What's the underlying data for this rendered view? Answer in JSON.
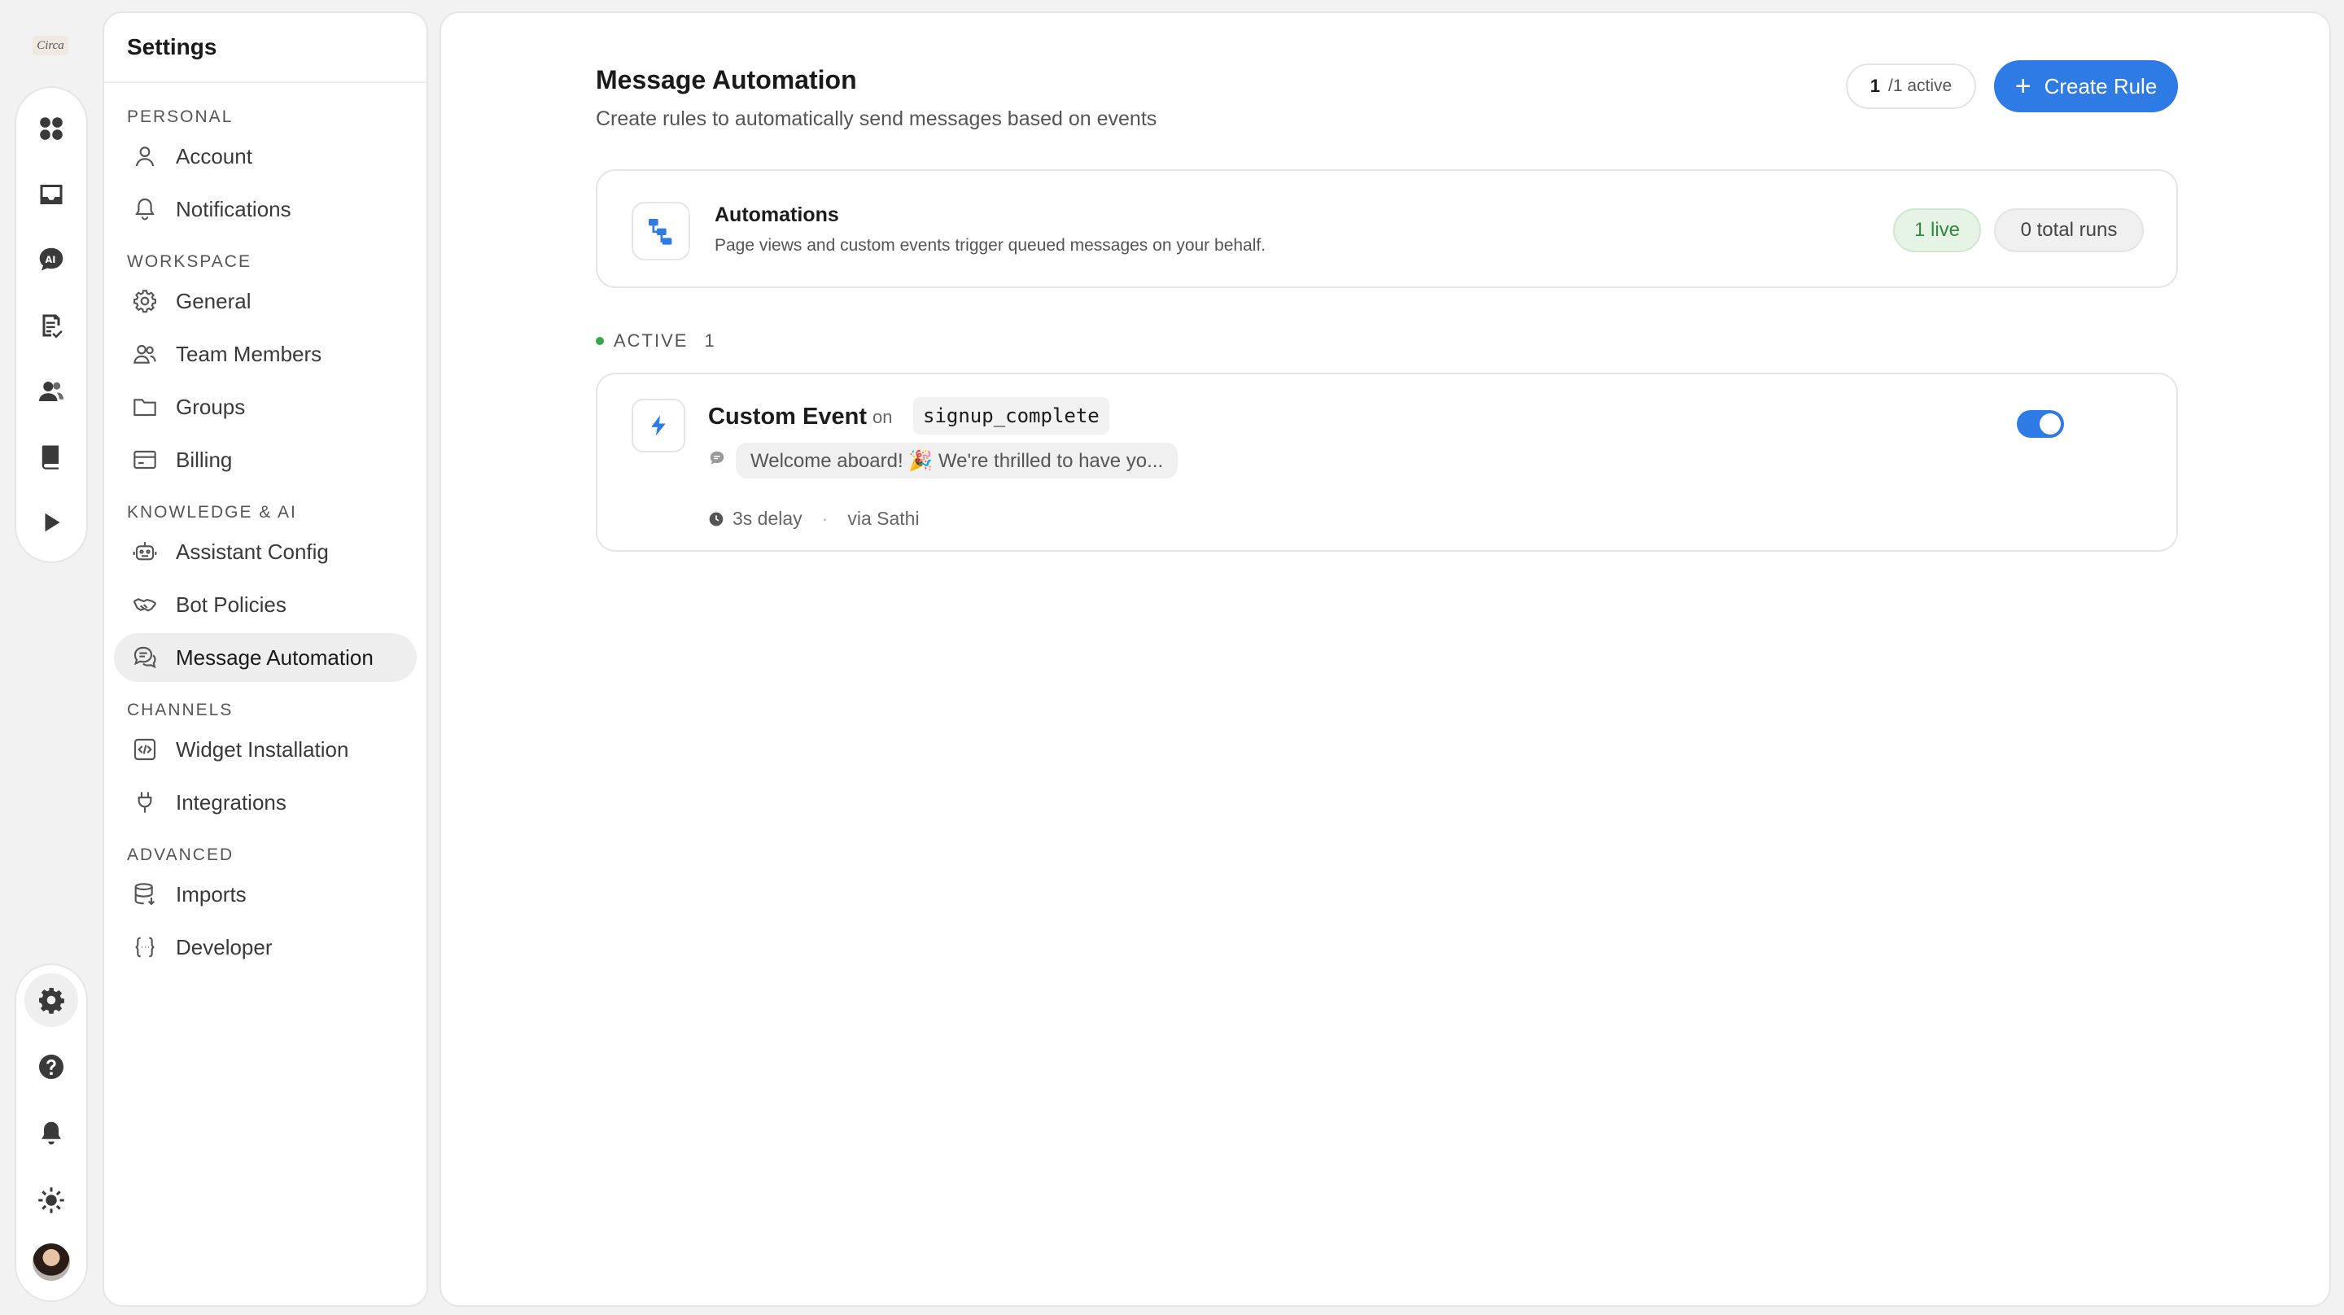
{
  "rail": {
    "logo_text": "Circa",
    "top_items": [
      {
        "name": "dashboard-icon"
      },
      {
        "name": "inbox-icon"
      },
      {
        "name": "ai-chat-icon"
      },
      {
        "name": "tasks-icon"
      },
      {
        "name": "contacts-icon"
      },
      {
        "name": "knowledge-book-icon"
      },
      {
        "name": "play-icon"
      }
    ],
    "bottom_items": [
      {
        "name": "settings-gear-icon",
        "active": true
      },
      {
        "name": "help-icon"
      },
      {
        "name": "bell-icon"
      },
      {
        "name": "theme-sun-icon"
      },
      {
        "name": "user-avatar"
      }
    ]
  },
  "settings": {
    "title": "Settings",
    "sections": [
      {
        "label": "PERSONAL",
        "items": [
          {
            "label": "Account",
            "icon": "user-icon"
          },
          {
            "label": "Notifications",
            "icon": "bell-outline-icon"
          }
        ]
      },
      {
        "label": "WORKSPACE",
        "items": [
          {
            "label": "General",
            "icon": "gear-outline-icon"
          },
          {
            "label": "Team Members",
            "icon": "team-icon"
          },
          {
            "label": "Groups",
            "icon": "folder-icon"
          },
          {
            "label": "Billing",
            "icon": "billing-card-icon"
          }
        ]
      },
      {
        "label": "KNOWLEDGE & AI",
        "items": [
          {
            "label": "Assistant Config",
            "icon": "robot-icon"
          },
          {
            "label": "Bot Policies",
            "icon": "handshake-icon"
          },
          {
            "label": "Message Automation",
            "icon": "chat-bubbles-icon",
            "active": true
          }
        ]
      },
      {
        "label": "CHANNELS",
        "items": [
          {
            "label": "Widget Installation",
            "icon": "code-box-icon"
          },
          {
            "label": "Integrations",
            "icon": "plug-icon"
          }
        ]
      },
      {
        "label": "ADVANCED",
        "items": [
          {
            "label": "Imports",
            "icon": "database-import-icon"
          },
          {
            "label": "Developer",
            "icon": "braces-icon"
          }
        ]
      }
    ]
  },
  "main": {
    "title": "Message Automation",
    "subtitle": "Create rules to automatically send messages based on events",
    "active_count": {
      "value": "1",
      "label": "/1 active"
    },
    "create_button": "Create Rule",
    "automations_card": {
      "title": "Automations",
      "description": "Page views and custom events trigger queued messages on your behalf.",
      "live_badge": "1 live",
      "runs_badge": "0 total runs"
    },
    "active_section": {
      "label": "ACTIVE",
      "count": "1"
    },
    "rule": {
      "title": "Custom Event",
      "on_label": "on",
      "event_code": "signup_complete",
      "message_preview": "Welcome aboard! 🎉 We're thrilled to have yo...",
      "delay": "3s delay",
      "separator": "·",
      "via": "via Sathi",
      "enabled": true
    },
    "colors": {
      "accent": "#2f7be5",
      "live_green": "#2f8a3a"
    }
  }
}
